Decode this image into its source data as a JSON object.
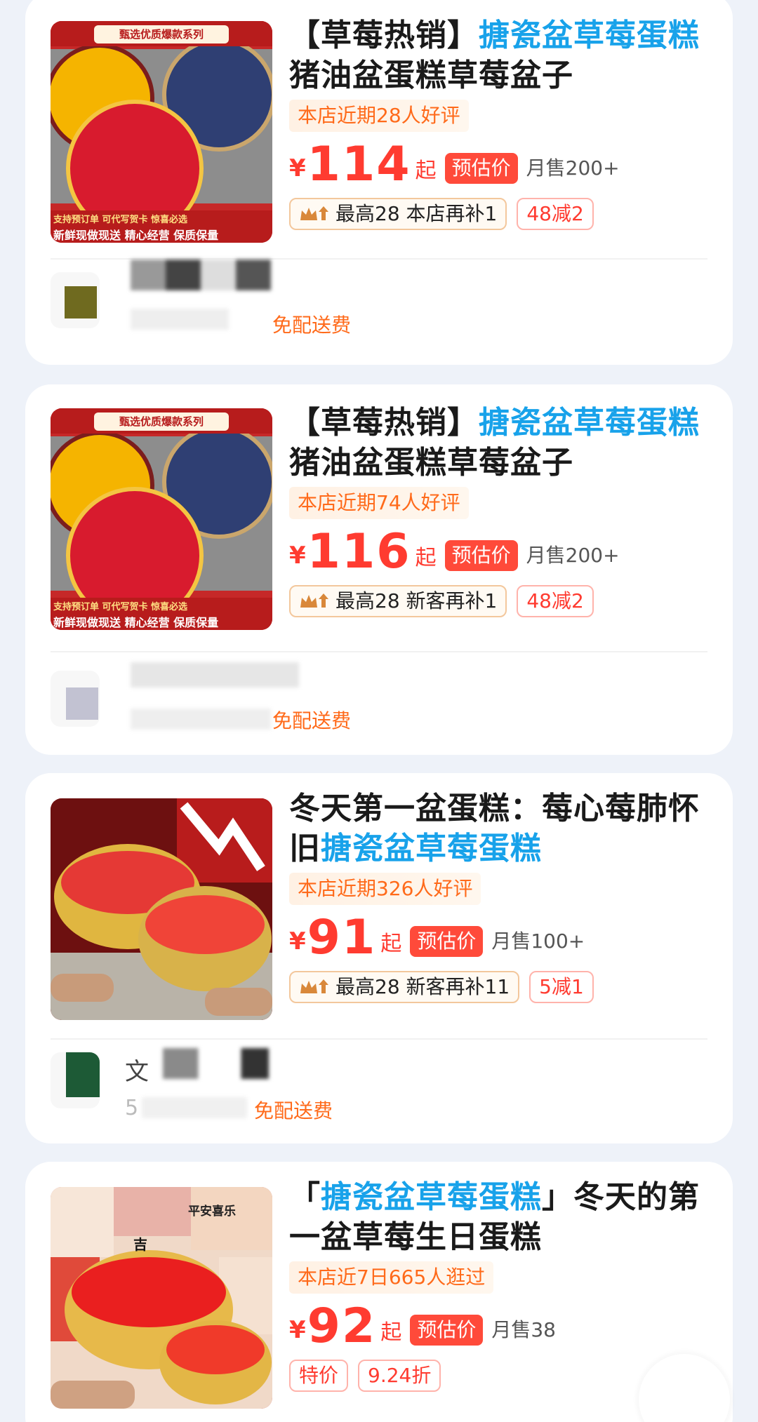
{
  "colors": {
    "accent_blue": "#18a2ea",
    "price_red": "#ff3b30",
    "tag_orange": "#ff6a1a",
    "page_bg": "#eef2f9"
  },
  "products": [
    {
      "thumb_banner": "甄选优质爆款系列",
      "thumb_caption_1": "支持预订单  可代写贺卡  惊喜必选",
      "thumb_caption_2": "新鲜现做现送  精心经营  保质保量",
      "title_prefix": "【草莓热销】",
      "title_highlight": "搪瓷盆草莓蛋糕",
      "title_suffix": "猪油盆蛋糕草莓盆子",
      "review_tag": "本店近期28人好评",
      "price_symbol": "¥",
      "price": "114",
      "price_suffix": "起",
      "est_label": "预估价",
      "sales": "月售200+",
      "promo_label": "最高28  本店再补1",
      "coupon": "48减2",
      "delivery": "免配送费"
    },
    {
      "thumb_banner": "甄选优质爆款系列",
      "thumb_caption_1": "支持预订单  可代写贺卡  惊喜必选",
      "thumb_caption_2": "新鲜现做现送  精心经营  保质保量",
      "title_prefix": "【草莓热销】",
      "title_highlight": "搪瓷盆草莓蛋糕",
      "title_suffix": "猪油盆蛋糕草莓盆子",
      "review_tag": "本店近期74人好评",
      "price_symbol": "¥",
      "price": "116",
      "price_suffix": "起",
      "est_label": "预估价",
      "sales": "月售200+",
      "promo_label": "最高28  新客再补1",
      "coupon": "48减2",
      "delivery": "免配送费"
    },
    {
      "title_prefix": "冬天第一盆蛋糕：莓心莓肺怀旧",
      "title_highlight": "搪瓷盆草莓蛋糕",
      "title_suffix": "",
      "review_tag": "本店近期326人好评",
      "price_symbol": "¥",
      "price": "91",
      "price_suffix": "起",
      "est_label": "预估价",
      "sales": "月售100+",
      "promo_label": "最高28  新客再补11",
      "coupon": "5减1",
      "shop_partial_1": "文",
      "shop_partial_2": "5",
      "delivery": "免配送费"
    },
    {
      "title_prefix": "「",
      "title_highlight": "搪瓷盆草莓蛋糕",
      "title_suffix": "」冬天的第一盆草莓生日蛋糕",
      "review_tag": "本店近7日665人逛过",
      "price_symbol": "¥",
      "price": "92",
      "price_suffix": "起",
      "est_label": "预估价",
      "sales": "月售38",
      "tag_special": "特价",
      "tag_discount": "9.24折",
      "thumb_notes": [
        "平安喜乐",
        "吉"
      ]
    }
  ]
}
